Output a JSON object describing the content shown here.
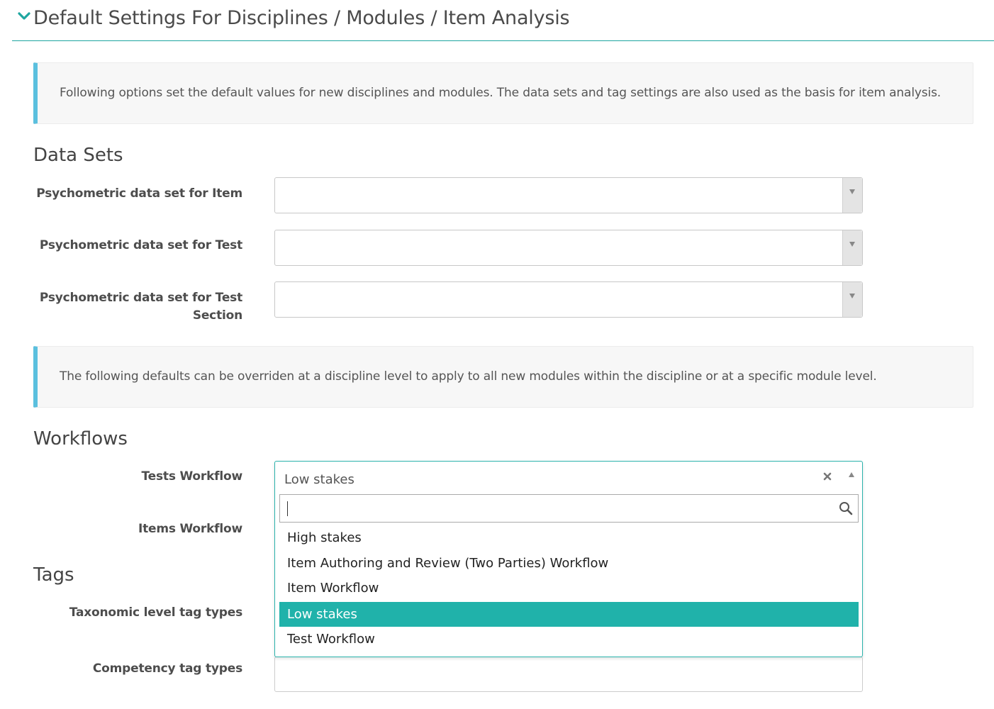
{
  "header": {
    "title": "Default Settings For Disciplines / Modules / Item Analysis"
  },
  "info": {
    "intro": "Following options set the default values for new disciplines and modules. The data sets and tag settings are also used as the basis for item analysis.",
    "override": "The following defaults can be overriden at a discipline level to apply to all new modules within the discipline or at a specific module level."
  },
  "data_sets": {
    "title": "Data Sets",
    "item_label": "Psychometric data set for Item",
    "test_label": "Psychometric data set for Test",
    "test_section_label_1": "Psychometric data set for Test",
    "test_section_label_2": "Section"
  },
  "workflows": {
    "title": "Workflows",
    "tests_label": "Tests Workflow",
    "items_label": "Items Workflow",
    "tests_value": "Low stakes",
    "search_value": "",
    "options": [
      "High stakes",
      "Item Authoring and Review (Two Parties) Workflow",
      "Item Workflow",
      "Low stakes",
      "Test Workflow"
    ],
    "selected_option": "Low stakes"
  },
  "tags": {
    "title": "Tags",
    "taxonomic_label": "Taxonomic level tag types",
    "competency_label": "Competency tag types"
  },
  "colors": {
    "accent": "#20b2aa",
    "info_border": "#5bc0de"
  },
  "icons": {
    "collapse": "chevron-down-icon",
    "dropdown": "caret-down-icon",
    "clear": "close-icon",
    "search": "search-icon"
  }
}
